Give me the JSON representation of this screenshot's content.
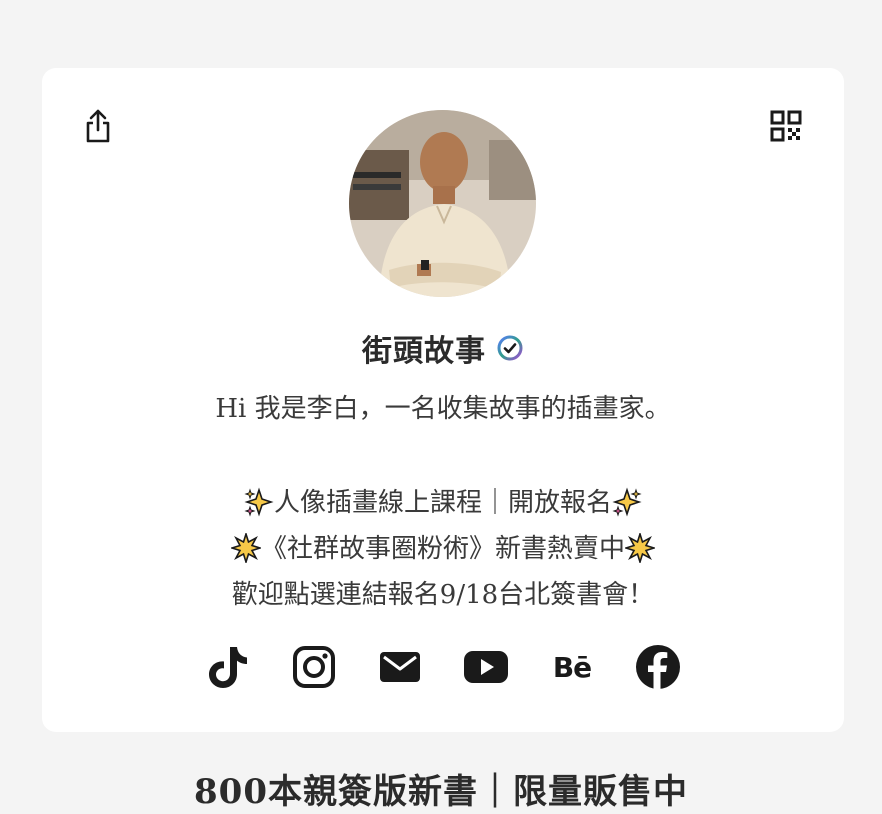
{
  "profile": {
    "name": "街頭故事",
    "verified_icon": "verified-badge-icon",
    "avatar_alt": "profile photo"
  },
  "header": {
    "share_icon": "share-icon",
    "qr_icon": "qr-code-icon"
  },
  "bio": {
    "line1": "Hi 我是李白，一名收集故事的插畫家。",
    "line2": "人像插畫線上課程｜開放報名",
    "line3": "《社群故事圈粉術》新書熱賣中",
    "line4": "歡迎點選連結報名9/18台北簽書會！"
  },
  "socials": [
    {
      "name": "tiktok-icon"
    },
    {
      "name": "instagram-icon"
    },
    {
      "name": "email-icon"
    },
    {
      "name": "youtube-icon"
    },
    {
      "name": "behance-icon",
      "text": "Bē"
    },
    {
      "name": "facebook-icon"
    }
  ],
  "section": {
    "heading": "800本親簽版新書｜限量販售中"
  },
  "colors": {
    "page_bg": "#f4f4f4",
    "card_bg": "#ffffff",
    "text": "#2c2c2c",
    "sparkle": "#f7c948"
  }
}
